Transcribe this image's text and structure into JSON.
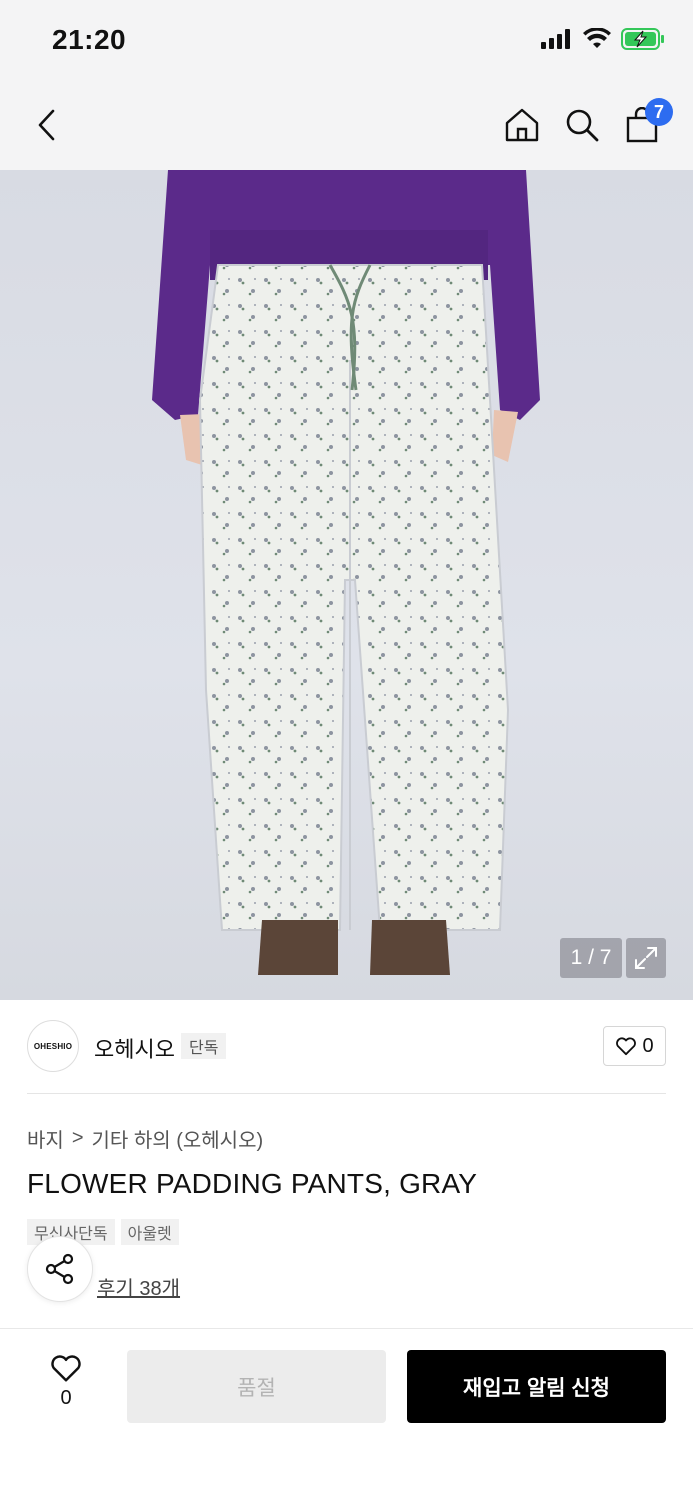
{
  "status_bar": {
    "time": "21:20"
  },
  "nav": {
    "cart_count": "7"
  },
  "image": {
    "counter": "1 / 7"
  },
  "brand": {
    "logo_text": "OHESHIO",
    "name": "오헤시오",
    "tag": "단독",
    "like_count": "0"
  },
  "breadcrumb": {
    "category": "바지",
    "separator": ">",
    "subcategory": "기타 하의 (오헤시오)"
  },
  "product": {
    "title": "FLOWER PADDING PANTS, GRAY",
    "tags": [
      "무신사단독",
      "아울렛"
    ],
    "reviews": "후기 38개"
  },
  "bottom": {
    "like_count": "0",
    "sold_out_label": "품절",
    "restock_label": "재입고 알림 신청"
  },
  "colors": {
    "accent_blue": "#2d6cf0",
    "battery_green": "#34c759",
    "sweater_purple": "#5b2a8a"
  }
}
